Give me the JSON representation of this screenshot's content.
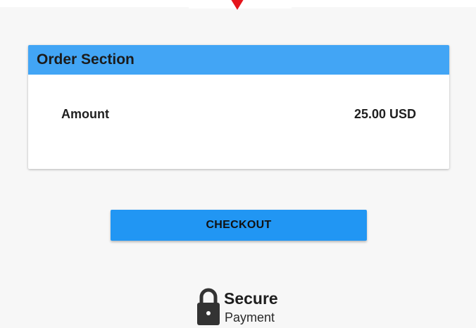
{
  "order": {
    "title": "Order Section",
    "amount_label": "Amount",
    "amount_value": "25.00 USD"
  },
  "actions": {
    "checkout_label": "CHECKOUT"
  },
  "secure": {
    "title": "Secure",
    "subtitle": "Payment",
    "icon": "lock-icon"
  },
  "colors": {
    "page_background": "#f7f7f7",
    "header_blue": "#42a5f5",
    "button_blue": "#2196f3",
    "marker_red": "#e5141b",
    "text_dark": "#1b1b1b"
  }
}
